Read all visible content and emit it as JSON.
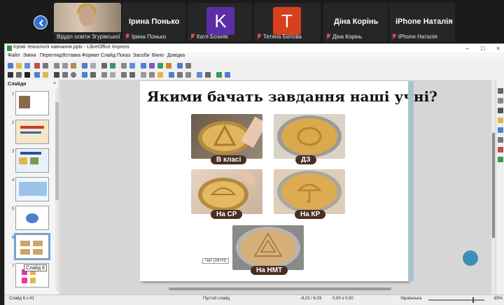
{
  "conference": {
    "participants": [
      {
        "name_overlay": "",
        "label": "Відділ освіти Згурівської ..."
      },
      {
        "name_overlay": "Ірина Понько",
        "label": "Ірина Понько"
      },
      {
        "name_overlay": "",
        "avatar_letter": "K",
        "label": "Катя Бозняк",
        "color": "#5b2ea6"
      },
      {
        "name_overlay": "",
        "avatar_letter": "T",
        "label": "Тетяна Белова",
        "color": "#d7401f"
      },
      {
        "name_overlay": "Діна Корінь",
        "label": "Діна Корінь"
      },
      {
        "name_overlay": "iPhone Наталія",
        "label": "iPhone Наталія"
      }
    ]
  },
  "window": {
    "title": "Ігрові технології навчання.pptx - LibreOffice Impress",
    "controls": [
      "–",
      "□",
      "×"
    ]
  },
  "menu": [
    "Файл",
    "Зміни",
    "Перегляд",
    "Вставка",
    "Формат",
    "Слайд",
    "Показ",
    "Засоби",
    "Вікно",
    "Довідка"
  ],
  "slides_panel": {
    "title": "Слайди",
    "close": "×",
    "thumbnails": [
      "1",
      "2",
      "3",
      "4",
      "5",
      "6",
      "7"
    ],
    "selected_index": 6,
    "tooltip": "Слайд 6"
  },
  "slide": {
    "title": "Якими бачать завдання наші учні?",
    "captions": [
      "В класі",
      "ДЗ",
      "На СР",
      "На КР",
      "На НМТ"
    ]
  },
  "status": {
    "slide_position": "Слайд 6 з 41",
    "layout": "Пустой слайд",
    "coords": "-8,02 / 6,03",
    "size": "0,00 x 0,00",
    "language": "Українська",
    "zoom": "85%",
    "hint": "Чат (Alt+H)"
  },
  "colors": {
    "caption_bg": "#4b2e22",
    "accent": "#3d8fb8",
    "selection": "#6aa7e8"
  }
}
